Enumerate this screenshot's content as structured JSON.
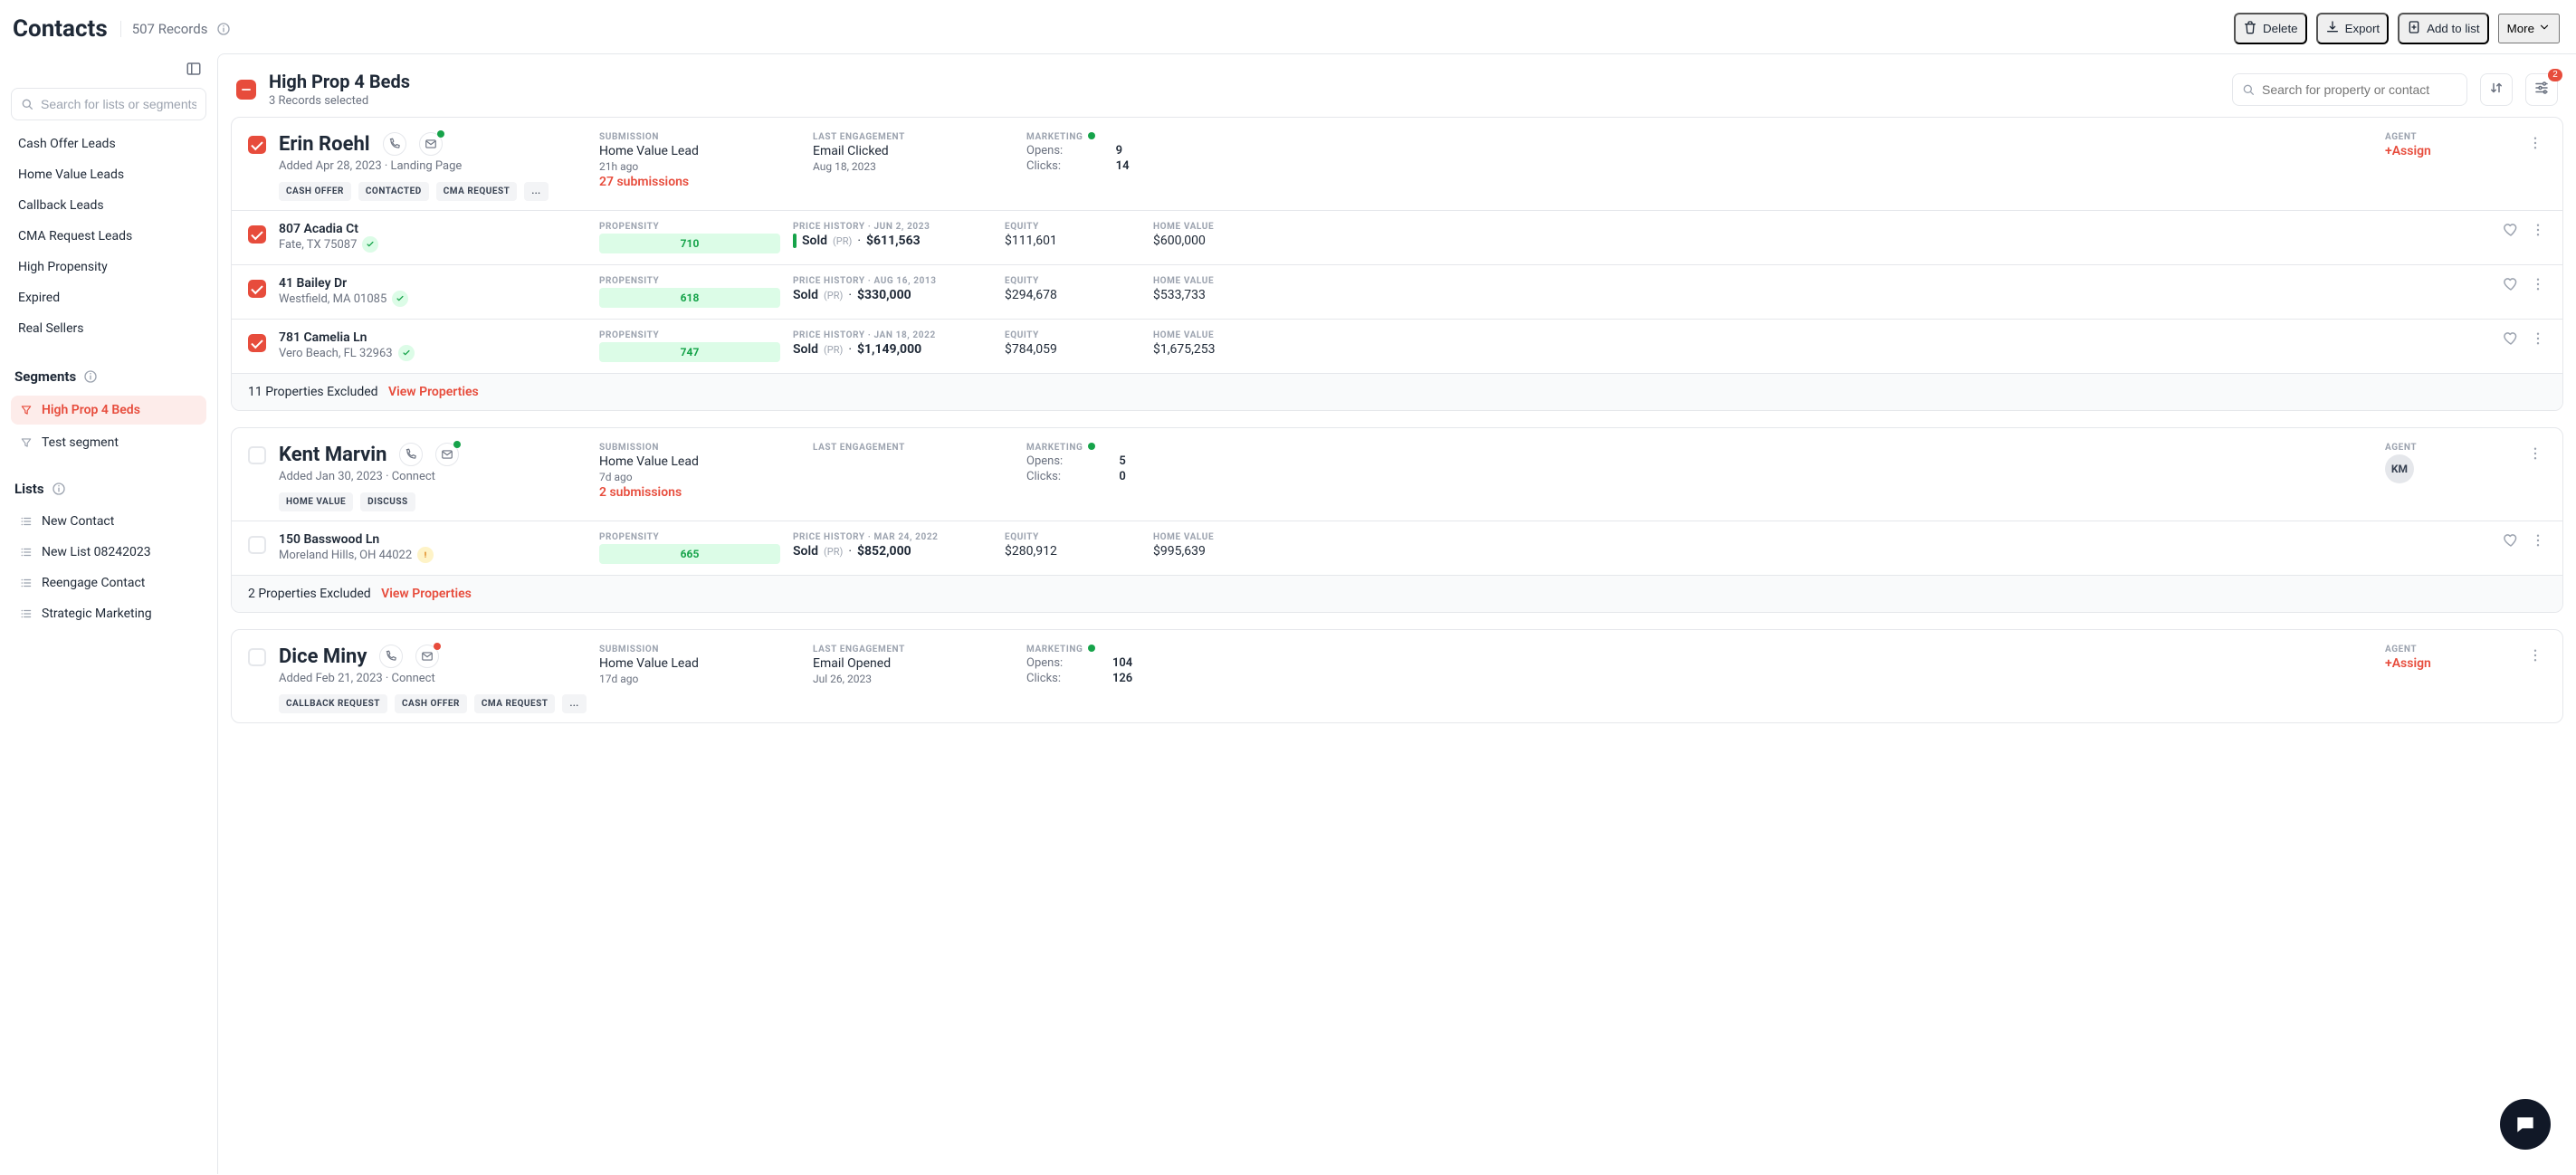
{
  "header": {
    "title": "Contacts",
    "record_count": "507 Records",
    "actions": {
      "delete": "Delete",
      "export": "Export",
      "add_to_list": "Add to list",
      "more": "More"
    }
  },
  "sidebar": {
    "search_placeholder": "Search for lists or segments",
    "nav": [
      "Cash Offer Leads",
      "Home Value Leads",
      "Callback Leads",
      "CMA Request Leads",
      "High Propensity",
      "Expired",
      "Real Sellers"
    ],
    "segments_label": "Segments",
    "segments": [
      {
        "label": "High Prop 4 Beds",
        "active": true
      },
      {
        "label": "Test segment",
        "active": false
      }
    ],
    "lists_label": "Lists",
    "lists": [
      "New Contact",
      "New List 08242023",
      "Reengage Contact",
      "Strategic Marketing"
    ]
  },
  "main_header": {
    "segment_title": "High Prop 4 Beds",
    "selected_text": "3 Records selected",
    "search_placeholder": "Search for property or contact",
    "filter_badge": "2"
  },
  "labels": {
    "submission": "SUBMISSION",
    "last_engagement": "LAST ENGAGEMENT",
    "marketing": "MARKETING",
    "agent": "AGENT",
    "opens": "Opens:",
    "clicks": "Clicks:",
    "propensity": "PROPENSITY",
    "price_history_prefix": "PRICE HISTORY · ",
    "equity": "EQUITY",
    "home_value": "HOME VALUE",
    "sold": "Sold",
    "pr": "(PR)",
    "assign": "+Assign",
    "view_properties": "View Properties"
  },
  "contacts": [
    {
      "id": "erin",
      "checked": true,
      "name": "Erin Roehl",
      "mail_dot": "green",
      "added_line": "Added Apr 28, 2023 · Landing Page",
      "chips": [
        "CASH OFFER",
        "CONTACTED",
        "CMA REQUEST",
        "..."
      ],
      "submission": {
        "line1": "Home Value Lead",
        "line2": "21h ago",
        "link": "27 submissions"
      },
      "engagement": {
        "line1": "Email Clicked",
        "line2": "Aug 18, 2023"
      },
      "marketing": {
        "opens": "9",
        "clicks": "14"
      },
      "agent": {
        "type": "assign"
      },
      "properties": [
        {
          "addr1": "807 Acadia Ct",
          "addr2": "Fate, TX 75087",
          "verify": "green",
          "score": "710",
          "history_date": "JUN 2, 2023",
          "price": "$611,563",
          "sold_bar": true,
          "equity": "$111,601",
          "home_value": "$600,000"
        },
        {
          "addr1": "41 Bailey Dr",
          "addr2": "Westfield, MA 01085",
          "verify": "green",
          "score": "618",
          "history_date": "AUG 16, 2013",
          "price": "$330,000",
          "sold_bar": false,
          "equity": "$294,678",
          "home_value": "$533,733"
        },
        {
          "addr1": "781 Camelia Ln",
          "addr2": "Vero Beach, FL 32963",
          "verify": "green",
          "score": "747",
          "history_date": "JAN 18, 2022",
          "price": "$1,149,000",
          "sold_bar": false,
          "equity": "$784,059",
          "home_value": "$1,675,253"
        }
      ],
      "excluded": "11 Properties Excluded"
    },
    {
      "id": "kent",
      "checked": false,
      "name": "Kent Marvin",
      "mail_dot": "green",
      "added_line": "Added Jan 30, 2023 · Connect",
      "chips": [
        "HOME VALUE",
        "DISCUSS"
      ],
      "submission": {
        "line1": "Home Value Lead",
        "line2": "7d ago",
        "link": "2 submissions"
      },
      "engagement": null,
      "marketing": {
        "opens": "5",
        "clicks": "0"
      },
      "agent": {
        "type": "avatar",
        "initials": "KM"
      },
      "properties": [
        {
          "addr1": "150 Basswood Ln",
          "addr2": "Moreland Hills, OH 44022",
          "verify": "amber",
          "score": "665",
          "history_date": "MAR 24, 2022",
          "price": "$852,000",
          "sold_bar": false,
          "equity": "$280,912",
          "home_value": "$995,639"
        }
      ],
      "excluded": "2 Properties Excluded"
    },
    {
      "id": "dice",
      "checked": false,
      "name": "Dice Miny",
      "mail_dot": "red",
      "added_line": "Added Feb 21, 2023 · Connect",
      "chips": [
        "CALLBACK REQUEST",
        "CASH OFFER",
        "CMA REQUEST",
        "..."
      ],
      "submission": {
        "line1": "Home Value Lead",
        "line2": "17d ago",
        "link": ""
      },
      "engagement": {
        "line1": "Email Opened",
        "line2": "Jul 26, 2023"
      },
      "marketing": {
        "opens": "104",
        "clicks": "126"
      },
      "agent": {
        "type": "assign"
      },
      "properties": [],
      "excluded": null
    }
  ]
}
